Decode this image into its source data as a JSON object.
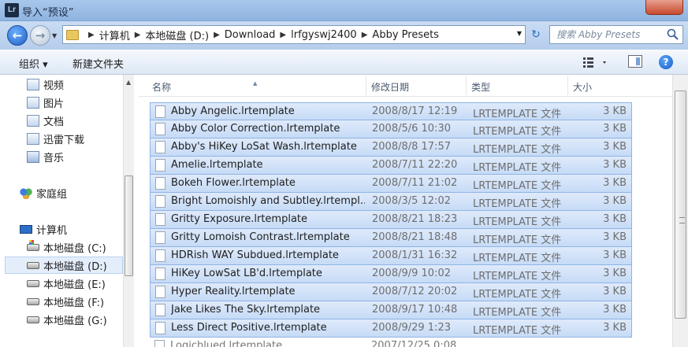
{
  "window": {
    "title": "导入“预设”",
    "app_icon": "Lr"
  },
  "nav": {
    "back_glyph": "←",
    "forward_glyph": "→",
    "breadcrumbs": [
      "计算机",
      "本地磁盘 (D:)",
      "Download",
      "lrfgyswj2400",
      "Abby Presets"
    ],
    "refresh_glyph": "↻",
    "search_placeholder": "搜索 Abby Presets"
  },
  "toolbar": {
    "organize_label": "组织 ▾",
    "new_folder_label": "新建文件夹",
    "help_glyph": "?"
  },
  "sidebar": {
    "libraries": [
      "视频",
      "图片",
      "文档",
      "迅雷下载",
      "音乐"
    ],
    "homegroup": "家庭组",
    "computer": "计算机",
    "drives": [
      "本地磁盘 (C:)",
      "本地磁盘 (D:)",
      "本地磁盘 (E:)",
      "本地磁盘 (F:)",
      "本地磁盘 (G:)"
    ],
    "selected_drive": "本地磁盘 (D:)"
  },
  "columns": {
    "name": "名称",
    "date": "修改日期",
    "type": "类型",
    "size": "大小"
  },
  "files": [
    {
      "name": "Abby Angelic.lrtemplate",
      "date": "2008/8/17 12:19",
      "type": "LRTEMPLATE 文件",
      "size": "3 KB"
    },
    {
      "name": "Abby Color Correction.lrtemplate",
      "date": "2008/5/6 10:30",
      "type": "LRTEMPLATE 文件",
      "size": "3 KB"
    },
    {
      "name": "Abby's HiKey LoSat Wash.lrtemplate",
      "date": "2008/8/8 17:57",
      "type": "LRTEMPLATE 文件",
      "size": "3 KB"
    },
    {
      "name": "Amelie.lrtemplate",
      "date": "2008/7/11 22:20",
      "type": "LRTEMPLATE 文件",
      "size": "3 KB"
    },
    {
      "name": "Bokeh Flower.lrtemplate",
      "date": "2008/7/11 21:02",
      "type": "LRTEMPLATE 文件",
      "size": "3 KB"
    },
    {
      "name": "Bright Lomoishly and Subtley.lrtempl...",
      "date": "2008/3/5 12:02",
      "type": "LRTEMPLATE 文件",
      "size": "3 KB"
    },
    {
      "name": "Gritty Exposure.lrtemplate",
      "date": "2008/8/21 18:23",
      "type": "LRTEMPLATE 文件",
      "size": "3 KB"
    },
    {
      "name": "Gritty Lomoish Contrast.lrtemplate",
      "date": "2008/8/21 18:48",
      "type": "LRTEMPLATE 文件",
      "size": "3 KB"
    },
    {
      "name": "HDRish WAY Subdued.lrtemplate",
      "date": "2008/1/31 16:32",
      "type": "LRTEMPLATE 文件",
      "size": "3 KB"
    },
    {
      "name": "HiKey LowSat LB'd.lrtemplate",
      "date": "2008/9/9 10:02",
      "type": "LRTEMPLATE 文件",
      "size": "3 KB"
    },
    {
      "name": "Hyper Reality.lrtemplate",
      "date": "2008/7/12 20:02",
      "type": "LRTEMPLATE 文件",
      "size": "3 KB"
    },
    {
      "name": "Jake Likes The Sky.lrtemplate",
      "date": "2008/9/17 10:48",
      "type": "LRTEMPLATE 文件",
      "size": "3 KB"
    },
    {
      "name": "Less Direct Positive.lrtemplate",
      "date": "2008/9/29 1:23",
      "type": "LRTEMPLATE 文件",
      "size": "3 KB"
    },
    {
      "name": "Logichlued.lrtemplate",
      "date": "2007/12/25 0:08",
      "type": "",
      "size": ""
    }
  ]
}
